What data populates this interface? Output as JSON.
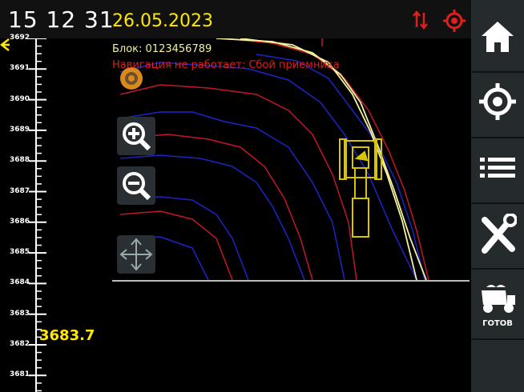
{
  "status": {
    "time": "15 12 31",
    "date": "26.05.2023"
  },
  "map": {
    "block_label": "Блок: 0123456789",
    "nav_error": "Навигация не работает: Сбой приемника"
  },
  "ruler": {
    "ticks": [
      "3692",
      "3691",
      "3690",
      "3689",
      "3688",
      "3687",
      "3686",
      "3685",
      "3684",
      "3683",
      "3682",
      "3681"
    ],
    "current_depth": "3683.7"
  },
  "sidebar": {
    "items": [
      {
        "icon": "home-icon"
      },
      {
        "icon": "target-icon"
      },
      {
        "icon": "list-icon"
      },
      {
        "icon": "tools-icon"
      },
      {
        "icon": "dump-truck-icon",
        "label": "ГОТОВ"
      }
    ]
  },
  "colors": {
    "accent": "#ffe800",
    "error": "#e01e1e",
    "sidebar": "#252a2c"
  }
}
